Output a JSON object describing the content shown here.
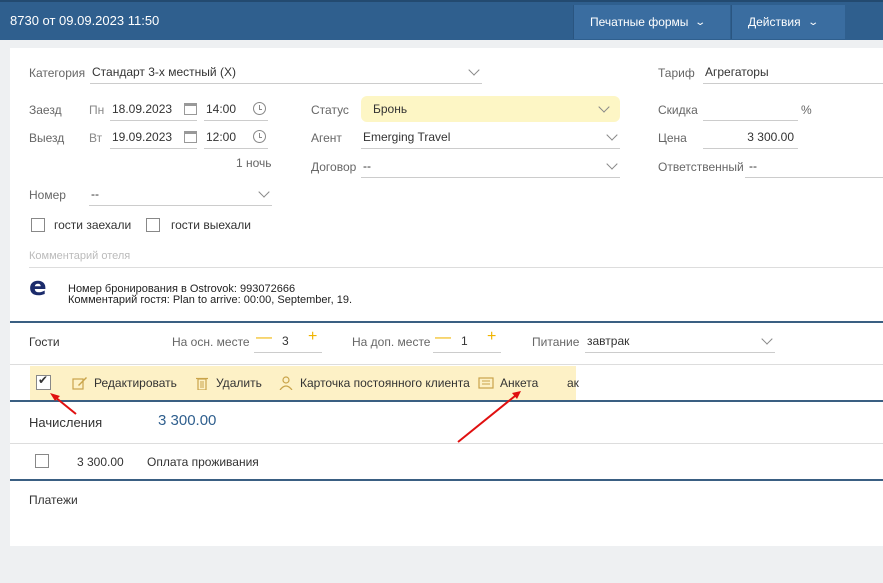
{
  "header": {
    "title": "8730 от 09.09.2023 11:50",
    "print_forms": "Печатные формы",
    "actions": "Действия"
  },
  "form": {
    "category_label": "Категория",
    "category_value": "Стандарт 3-х местный (X)",
    "tariff_label": "Тариф",
    "tariff_value": "Агрегаторы",
    "checkin_label": "Заезд",
    "checkin_day": "Пн",
    "checkin_date": "18.09.2023",
    "checkin_time": "14:00",
    "checkout_label": "Выезд",
    "checkout_day": "Вт",
    "checkout_date": "19.09.2023",
    "checkout_time": "12:00",
    "nights": "1 ночь",
    "status_label": "Статус",
    "status_value": "Бронь",
    "agent_label": "Агент",
    "agent_value": "Emerging Travel",
    "contract_label": "Договор",
    "contract_value": "--",
    "discount_label": "Скидка",
    "discount_unit": "%",
    "price_label": "Цена",
    "price_value": "3 300.00",
    "responsible_label": "Ответственный",
    "responsible_value": "--",
    "room_label": "Номер",
    "room_value": "--",
    "guests_arrived": "гости заехали",
    "guests_left": "гости выехали",
    "comment_placeholder": "Комментарий отеля"
  },
  "note": {
    "logo_letter": "e",
    "line1": "Номер бронирования в Ostrovok: 993072666",
    "line2": "Комментарий гостя: Plan to arrive: 00:00, September, 19."
  },
  "guests": {
    "label": "Гости",
    "main_label": "На осн. месте",
    "main_count": "3",
    "extra_label": "На доп. месте",
    "extra_count": "1",
    "meal_label": "Питание",
    "meal_value": "завтрак",
    "minus": "—",
    "plus": "+"
  },
  "toolbar": {
    "edit": "Редактировать",
    "delete": "Удалить",
    "loyalty_card": "Карточка постоянного клиента",
    "form": "Анкета",
    "trailing": "ак"
  },
  "charges": {
    "label": "Начисления",
    "total": "3 300.00",
    "rows": [
      {
        "amount": "3 300.00",
        "description": "Оплата проживания"
      }
    ]
  },
  "payments": {
    "label": "Платежи"
  }
}
